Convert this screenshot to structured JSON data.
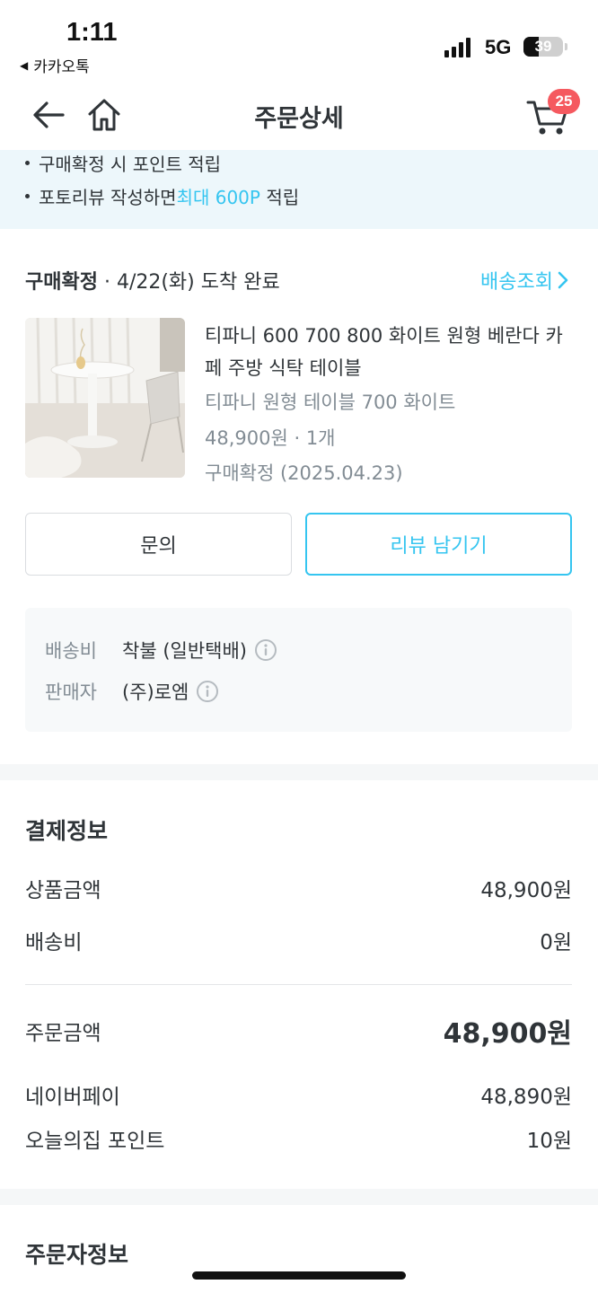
{
  "status_bar": {
    "time": "1:11",
    "back_app": "카카오톡",
    "network": "5G",
    "battery": "39",
    "battery_level": 0.39
  },
  "header": {
    "title": "주문상세",
    "cart_count": "25"
  },
  "notice": {
    "line1": "구매확정 시 포인트 적립",
    "line2_prefix": "포토리뷰 작성하면 ",
    "line2_highlight": "최대 600P",
    "line2_suffix": " 적립"
  },
  "order": {
    "status": "구매확정",
    "status_detail": " · 4/22(화) 도착 완료",
    "track_label": "배송조회",
    "product": {
      "name": "티파니 600 700 800 화이트 원형 베란다 카페 주방 식탁 테이블",
      "option": "티파니 원형 테이블 700 화이트",
      "price_qty": "48,900원 · 1개",
      "confirm": "구매확정 (2025.04.23)"
    },
    "buttons": {
      "inquiry": "문의",
      "review": "리뷰 남기기"
    },
    "shipping": {
      "fee_label": "배송비",
      "fee_value": "착불 (일반택배)",
      "seller_label": "판매자",
      "seller_value": "(주)로엠"
    }
  },
  "payment": {
    "title": "결제정보",
    "rows": [
      {
        "label": "상품금액",
        "value": "48,900원"
      },
      {
        "label": "배송비",
        "value": "0원"
      }
    ],
    "total": {
      "label": "주문금액",
      "value": "48,900원"
    },
    "methods": [
      {
        "label": "네이버페이",
        "value": "48,890원"
      },
      {
        "label": "오늘의집 포인트",
        "value": "10원"
      }
    ]
  },
  "orderer": {
    "title": "주문자정보"
  },
  "colors": {
    "accent": "#35c5f0",
    "badge": "#f5595f",
    "text": "#2f3438",
    "muted": "#828c94"
  }
}
